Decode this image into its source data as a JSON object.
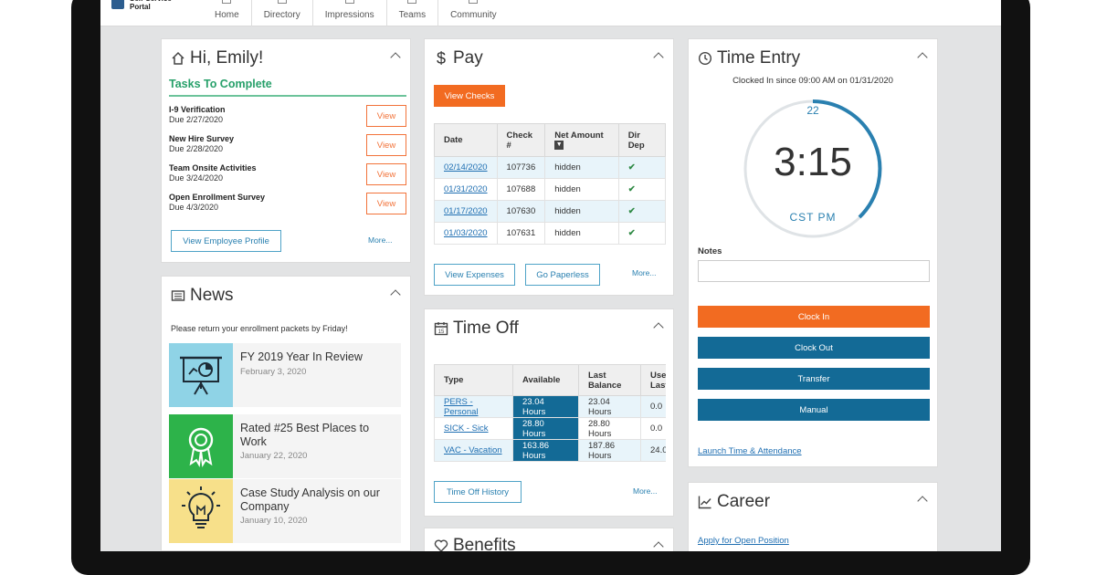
{
  "brand": {
    "title": "Self-Service Portal"
  },
  "nav": [
    "Home",
    "Directory",
    "Impressions",
    "Teams",
    "Community"
  ],
  "greeting": {
    "title": "Hi, Emily!",
    "tasks_title": "Tasks To Complete",
    "tasks": [
      {
        "name": "I-9 Verification",
        "due": "Due 2/27/2020",
        "action": "View"
      },
      {
        "name": "New Hire Survey",
        "due": "Due 2/28/2020",
        "action": "View"
      },
      {
        "name": "Team Onsite Activities",
        "due": "Due 3/24/2020",
        "action": "View"
      },
      {
        "name": "Open Enrollment Survey",
        "due": "Due 4/3/2020",
        "action": "View"
      }
    ],
    "profile_button": "View Employee Profile",
    "more": "More..."
  },
  "news": {
    "title": "News",
    "note": "Please return your enrollment packets by Friday!",
    "items": [
      {
        "title": "FY 2019 Year In Review",
        "date": "February 3, 2020",
        "thumb_color": "#8fd3e6",
        "icon": "presentation-chart-icon"
      },
      {
        "title": "Rated #25 Best Places to Work",
        "date": "January 22, 2020",
        "thumb_color": "#2db34a",
        "icon": "award-ribbon-icon"
      },
      {
        "title": "Case Study Analysis on our Company",
        "date": "January 10, 2020",
        "thumb_color": "#f7e08a",
        "icon": "lightbulb-icon"
      }
    ]
  },
  "pay": {
    "title": "Pay",
    "view_checks": "View Checks",
    "headers": [
      "Date",
      "Check #",
      "Net Amount",
      "Dir Dep"
    ],
    "rows": [
      {
        "date": "02/14/2020",
        "check": "107736",
        "net": "hidden",
        "dep": "✔"
      },
      {
        "date": "01/31/2020",
        "check": "107688",
        "net": "hidden",
        "dep": "✔"
      },
      {
        "date": "01/17/2020",
        "check": "107630",
        "net": "hidden",
        "dep": "✔"
      },
      {
        "date": "01/03/2020",
        "check": "107631",
        "net": "hidden",
        "dep": "✔"
      }
    ],
    "view_expenses": "View Expenses",
    "go_paperless": "Go Paperless",
    "more": "More..."
  },
  "timeoff": {
    "title": "Time Off",
    "headers": [
      "Type",
      "Available",
      "Last Balance",
      "Used Last"
    ],
    "rows": [
      {
        "type": "PERS - Personal",
        "available": "23.04 Hours",
        "last": "23.04 Hours",
        "used": "0.0"
      },
      {
        "type": "SICK - Sick",
        "available": "28.80 Hours",
        "last": "28.80 Hours",
        "used": "0.0"
      },
      {
        "type": "VAC - Vacation",
        "available": "163.86 Hours",
        "last": "187.86 Hours",
        "used": "24.0"
      }
    ],
    "history_button": "Time Off History",
    "more": "More..."
  },
  "benefits": {
    "title": "Benefits"
  },
  "time_entry": {
    "title": "Time Entry",
    "clocked": "Clocked In since 09:00 AM on 01/31/2020",
    "minute": "22",
    "time": "3:15",
    "tz": "CST  PM",
    "notes_label": "Notes",
    "buttons": [
      "Clock In",
      "Clock Out",
      "Transfer",
      "Manual"
    ],
    "launch_link": "Launch Time & Attendance"
  },
  "career": {
    "title": "Career",
    "link": "Apply for Open Position"
  },
  "colors": {
    "accent_orange": "#f26b21",
    "primary_blue": "#136a96",
    "green": "#27a06a"
  }
}
